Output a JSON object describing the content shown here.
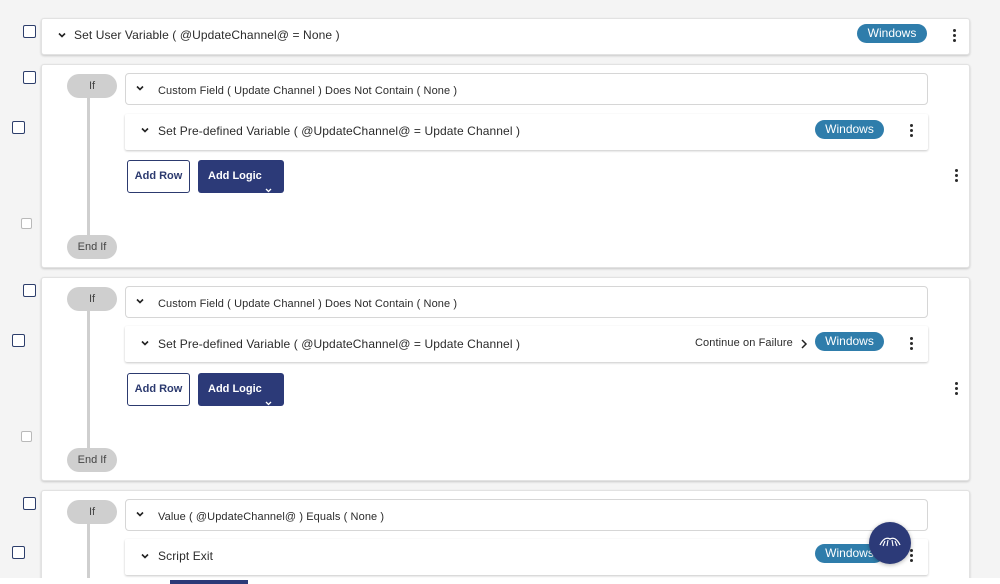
{
  "rows": {
    "user_variable": {
      "label": "Set User Variable ( @UpdateChannel@ = None )",
      "os_badge": "Windows"
    },
    "block1": {
      "if_label": "If",
      "end_if_label": "End If",
      "condition": "Custom Field ( Update Channel ) Does Not Contain ( None )",
      "action": "Set Pre-defined Variable ( @UpdateChannel@ = Update Channel )",
      "os_badge": "Windows",
      "add_row": "Add Row",
      "add_logic": "Add Logic"
    },
    "block2": {
      "if_label": "If",
      "end_if_label": "End If",
      "condition": "Custom Field ( Update Channel ) Does Not Contain ( None )",
      "action": "Set Pre-defined Variable ( @UpdateChannel@ = Update Channel )",
      "continue_on_failure": "Continue on Failure",
      "os_badge": "Windows",
      "add_row": "Add Row",
      "add_logic": "Add Logic"
    },
    "block3": {
      "if_label": "If",
      "condition": "Value ( @UpdateChannel@ ) Equals ( None )",
      "action": "Script Exit",
      "os_badge": "Windows"
    }
  },
  "colors": {
    "badge": "#2f7dab",
    "primary": "#2c3a78",
    "pill": "#cfcfcf"
  },
  "icons": {
    "fab": "chat-assistant-icon",
    "row_toggle": "chevron-down-icon",
    "menu": "kebab-menu-icon",
    "drag": "drag-handle-icon"
  }
}
